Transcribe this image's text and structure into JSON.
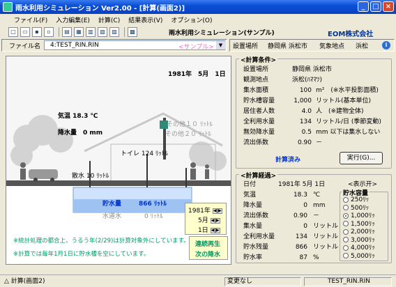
{
  "window": {
    "title": "雨水利用シミュレーション Ver2.00 - [計算(画面2)]",
    "buttons": [
      "_",
      "□",
      "×"
    ]
  },
  "menu": [
    "ファイル(F)",
    "入力編集(E)",
    "計算(C)",
    "結果表示(V)",
    "オプション(O)"
  ],
  "toolbar": {
    "caption": "雨水利用シミュレーション(サンプル)",
    "company": "EOM株式会社"
  },
  "file": {
    "label": "ファイル名",
    "value": "4:TEST_RIN.RIN",
    "sample_tag": "<サンプル>",
    "location_label": "設置場所",
    "location_value": "静岡県 浜松市",
    "station_label": "気象地点",
    "station_value": "浜松"
  },
  "scene": {
    "date": "1981年　5月　1日",
    "temp": "気温 18.3 ℃",
    "rain": "降水量　0 mm",
    "other1": "その他１０ ﾘｯﾄﾙ",
    "other2": "その他２０ ﾘｯﾄﾙ",
    "toilet": "トイレ 124 ﾘｯﾄﾙ",
    "sprinkle": "散水 10 ﾘｯﾄﾙ",
    "storage_label": "貯水量",
    "storage_value": "866 ﾘｯﾄﾙ",
    "tap_label": "水道水",
    "tap_value": "0 ﾘｯﾄﾙ",
    "year": "1981年",
    "month": "5月",
    "day": "1日",
    "note1": "※統計処理の都合上、うるう年(2/29)は計算対象外にしています。",
    "note2": "※計算では毎年1月1日に貯水槽を空にしています。",
    "btn_play": "連続再生",
    "btn_next": "次の降水"
  },
  "conditions": {
    "title": "<計算条件>",
    "rows": [
      {
        "label": "設置場所",
        "value": "静岡県 浜松市",
        "unit": ""
      },
      {
        "label": "観測地点",
        "value": "浜松(ﾊﾏﾏﾂ)",
        "unit": ""
      },
      {
        "label": "集水面積",
        "value": "100",
        "unit": "m²　(※水平投影面積)"
      },
      {
        "label": "貯水槽容量",
        "value": "1,000",
        "unit": "リットル(基本単位)"
      },
      {
        "label": "居住者人数",
        "value": "4.0",
        "unit": "人　(※建物全体)"
      },
      {
        "label": "全利用水量",
        "value": "134",
        "unit": "リットル/日 (季節変動)"
      },
      {
        "label": "無効降水量",
        "value": "0.5",
        "unit": "mm 以下は集水しない"
      },
      {
        "label": "流出係数",
        "value": "0.90",
        "unit": "－"
      }
    ],
    "status": "計算済み",
    "run_button": "実行(G)..."
  },
  "progress": {
    "title": "<計算経過>",
    "display_label": "<表示开>",
    "rows": [
      {
        "label": "日付",
        "value": "1981年 5月 1日",
        "unit": ""
      },
      {
        "label": "気温",
        "value": "18.3",
        "unit": "℃"
      },
      {
        "label": "降水量",
        "value": "0",
        "unit": "mm"
      },
      {
        "label": "流出係数",
        "value": "0.90",
        "unit": "－"
      },
      {
        "label": "集水量",
        "value": "0",
        "unit": "リットル"
      },
      {
        "label": "全利用水量",
        "value": "134",
        "unit": "リットル"
      },
      {
        "label": "貯水残量",
        "value": "866",
        "unit": "リットル"
      },
      {
        "label": "貯水率",
        "value": "87",
        "unit": "%"
      }
    ],
    "capacity_title": "貯水容量",
    "capacity_options": [
      "250ﾘｯ",
      "500ﾘｯ",
      "1,000ﾘｯ",
      "1,500ﾘｯ",
      "2,000ﾘｯ",
      "3,000ﾘｯ",
      "4,000ﾘｯ",
      "5,000ﾘｯ"
    ],
    "capacity_selected": 2
  },
  "status": {
    "left": "計算(画面2)",
    "middle": "変更なし",
    "right": "TEST_RIN.RIN"
  }
}
